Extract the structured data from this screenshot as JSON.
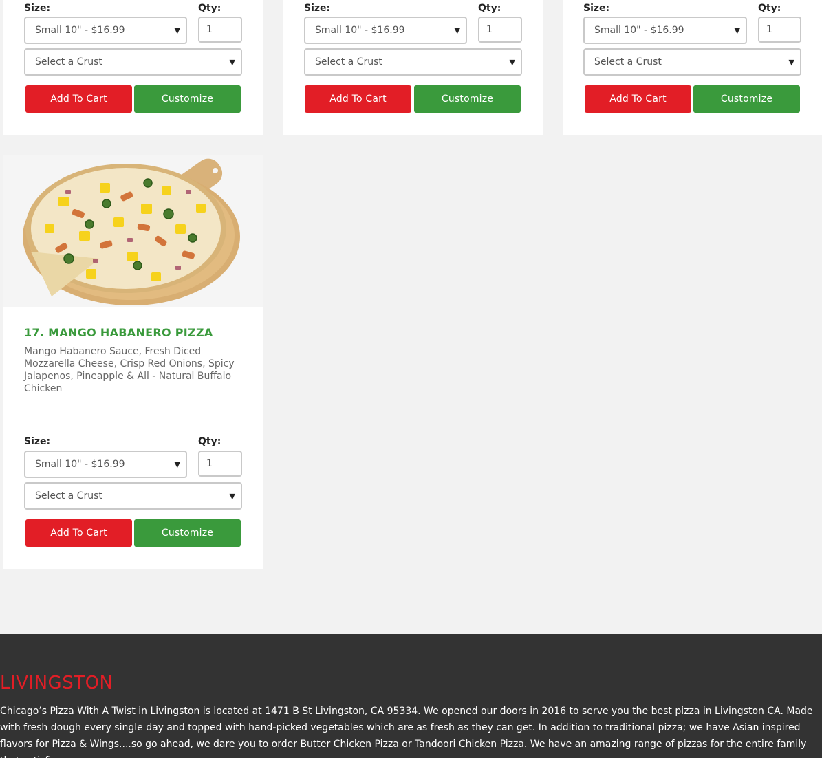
{
  "product_cards": [
    {
      "size_label": "Size:",
      "size_value": "Small 10\" - $16.99",
      "qty_label": "Qty:",
      "qty_value": "1",
      "crust_value": "Select a Crust",
      "add_label": "Add To Cart",
      "customize_label": "Customize"
    },
    {
      "size_label": "Size:",
      "size_value": "Small 10\" - $16.99",
      "qty_label": "Qty:",
      "qty_value": "1",
      "crust_value": "Select a Crust",
      "add_label": "Add To Cart",
      "customize_label": "Customize"
    },
    {
      "size_label": "Size:",
      "size_value": "Small 10\" - $16.99",
      "qty_label": "Qty:",
      "qty_value": "1",
      "crust_value": "Select a Crust",
      "add_label": "Add To Cart",
      "customize_label": "Customize"
    },
    {
      "title": "17. MANGO HABANERO PIZZA",
      "description": "Mango Habanero Sauce, Fresh Diced Mozzarella Cheese, Crisp Red Onions, Spicy Jalapenos, Pineapple & All - Natural Buffalo Chicken",
      "size_label": "Size:",
      "size_value": "Small 10\" - $16.99",
      "qty_label": "Qty:",
      "qty_value": "1",
      "crust_value": "Select a Crust",
      "add_label": "Add To Cart",
      "customize_label": "Customize"
    }
  ],
  "footer": {
    "title": "LIVINGSTON",
    "text": "Chicago’s Pizza With A Twist in Livingston is located at 1471 B St Livingston, CA 95334. We opened our doors in 2016 to serve you the best pizza in Livingston CA. Made with fresh dough every single day and topped with hand-picked vegetables which are as fresh as they can get. In addition to traditional pizza; we have Asian inspired flavors for Pizza & Wings....so go ahead, we dare you to order Butter Chicken Pizza or Tandoori Chicken Pizza. We have an amazing range of pizzas for the entire family that satisfies"
  },
  "icons": {
    "select_arrow": "chevron-down-icon"
  },
  "colors": {
    "accent_red": "#e21e26",
    "accent_green": "#3a9a3c",
    "footer_bg": "#333333"
  }
}
